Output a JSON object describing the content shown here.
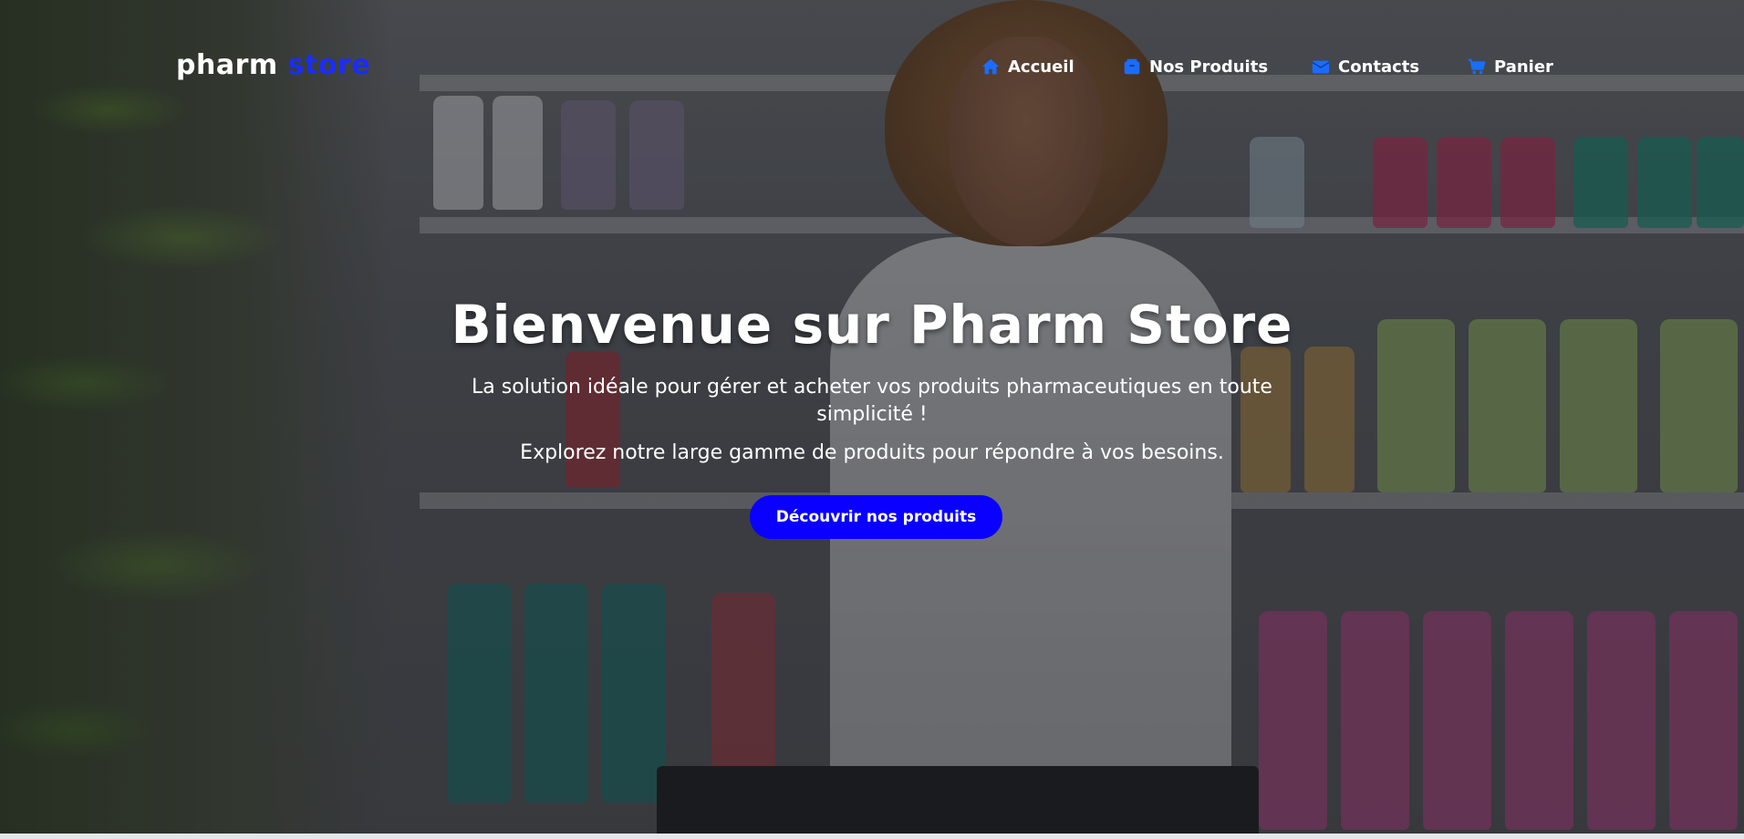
{
  "logo": {
    "part1": "pharm",
    "part2": "store"
  },
  "nav": [
    {
      "label": "Accueil",
      "icon": "home-icon"
    },
    {
      "label": "Nos Produits",
      "icon": "box-icon"
    },
    {
      "label": "Contacts",
      "icon": "envelope-icon"
    },
    {
      "label": "Panier",
      "icon": "cart-icon"
    }
  ],
  "hero": {
    "title": "Bienvenue sur Pharm Store",
    "subtitle1": "La solution idéale pour gérer et acheter vos produits pharmaceutiques en toute simplicité !",
    "subtitle2": "Explorez notre large gamme de produits pour répondre à vos besoins.",
    "cta_label": "Découvrir nos produits"
  },
  "colors": {
    "accent": "#0a00ff",
    "nav_icon": "#1a6cff",
    "logo_accent": "#1a2cff"
  }
}
